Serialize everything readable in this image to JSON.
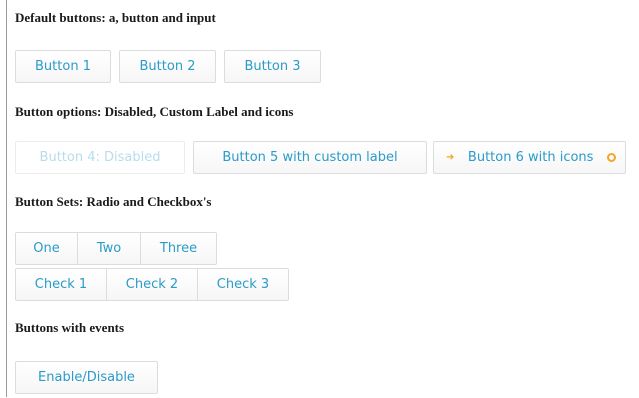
{
  "sections": {
    "default": {
      "heading": "Default buttons: a, button and input",
      "buttons": [
        "Button 1",
        "Button 2",
        "Button 3"
      ]
    },
    "options": {
      "heading": "Button options: Disabled, Custom Label and icons",
      "disabled_label": "Button 4: Disabled",
      "custom_label": "Button 5 with custom label",
      "icons_label": "Button 6 with icons"
    },
    "sets": {
      "heading": "Button Sets: Radio and Checkbox's",
      "radio": [
        "One",
        "Two",
        "Three"
      ],
      "checkbox": [
        "Check 1",
        "Check 2",
        "Check 3"
      ]
    },
    "events": {
      "heading": "Buttons with events",
      "toggle_label": "Enable/Disable"
    }
  },
  "colors": {
    "label": "#2b9bc8",
    "disabled_label": "#b8dcec",
    "icon": "#f5a623",
    "border": "#dcdcdc"
  },
  "icons": {
    "primary": "arrow-right-icon",
    "secondary": "circle-icon"
  }
}
